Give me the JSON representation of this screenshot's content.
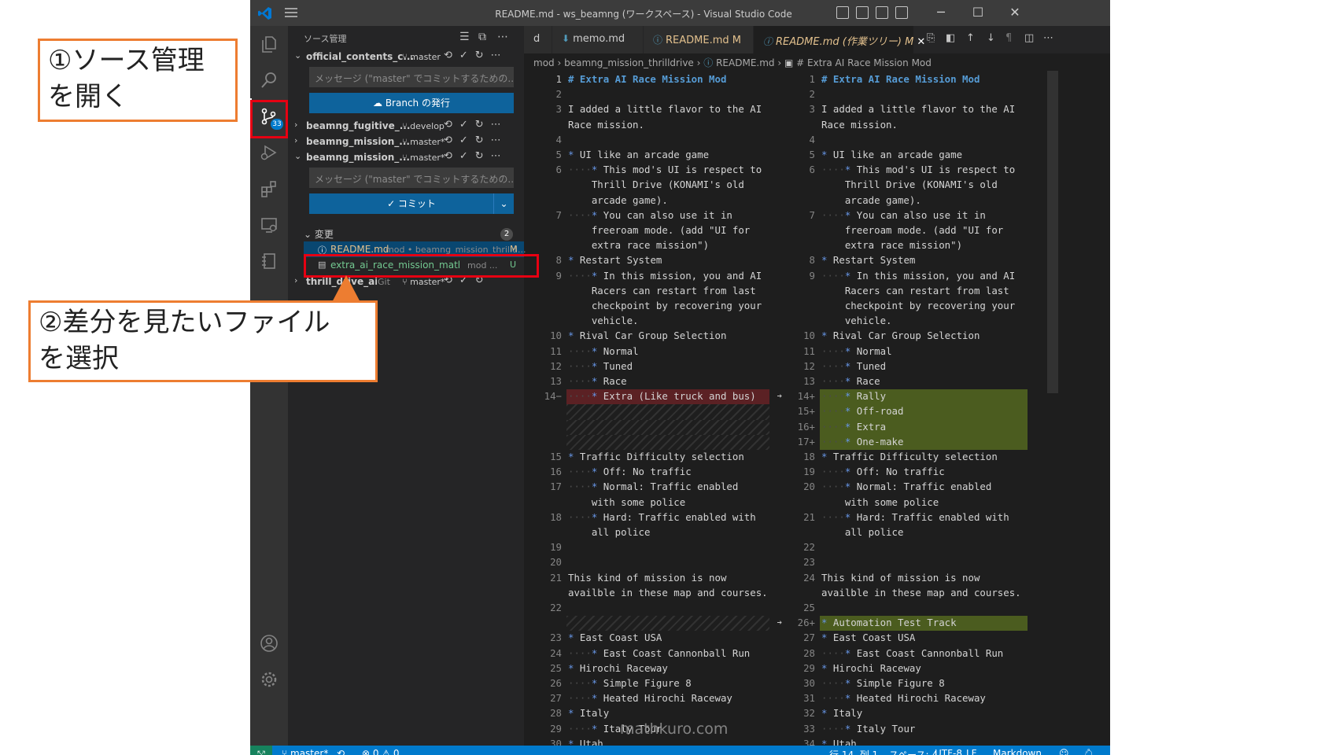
{
  "window": {
    "title": "README.md - ws_beamng (ワークスペース) - Visual Studio Code",
    "controls": [
      "─",
      "☐",
      "✕"
    ]
  },
  "activity_bar": {
    "scm_badge": "33"
  },
  "sidebar": {
    "title": "ソース管理",
    "repos": [
      {
        "name": "official_contents_c...",
        "branch": "master",
        "expanded": true
      },
      {
        "name": "beamng_fugitive_...",
        "branch": "develop",
        "expanded": false
      },
      {
        "name": "beamng_mission_...",
        "branch": "master*",
        "expanded": false
      },
      {
        "name": "beamng_mission_...",
        "branch": "master*",
        "expanded": true
      },
      {
        "name": "thrill_drive_ai...",
        "git_label": "Git",
        "branch": "master*",
        "expanded": false
      }
    ],
    "commit_placeholder": "メッセージ (\"master\" でコミットするための...",
    "publish_button": "Branch の発行",
    "commit_button": "✓ コミット",
    "changes_label": "変更",
    "changes_count": "2",
    "files": [
      {
        "name": "README.md",
        "desc": "mod • beamng_mission_thrilld...",
        "status": "M",
        "selected": true
      },
      {
        "name": "extra_ai_race_mission_mathkuro.zip",
        "desc": "mod ...",
        "status": "U",
        "selected": false
      }
    ]
  },
  "tabs": [
    {
      "label": "d",
      "active": false
    },
    {
      "label": "memo.md",
      "active": false
    },
    {
      "label": "README.md",
      "status": "M",
      "active": false
    },
    {
      "label": "README.md (作業ツリー)",
      "status": "M",
      "active": true
    }
  ],
  "breadcrumb": {
    "parts": [
      "mod",
      "beamng_mission_thrilldrive",
      "README.md",
      "# Extra AI Race Mission Mod"
    ]
  },
  "diff": {
    "left": [
      {
        "ln": "1",
        "t": "# Extra AI Race Mission Mod",
        "cur": true
      },
      {
        "ln": "2",
        "t": ""
      },
      {
        "ln": "3",
        "t": "I added a little flavor to the AI"
      },
      {
        "ln": "",
        "t": "Race mission."
      },
      {
        "ln": "4",
        "t": ""
      },
      {
        "ln": "5",
        "t": "* UI like an arcade game"
      },
      {
        "ln": "6",
        "t": "    * This mod's UI is respect to"
      },
      {
        "ln": "",
        "t": "    Thrill Drive (KONAMI's old"
      },
      {
        "ln": "",
        "t": "    arcade game)."
      },
      {
        "ln": "7",
        "t": "    * You can also use it in"
      },
      {
        "ln": "",
        "t": "    freeroam mode. (add \"UI for"
      },
      {
        "ln": "",
        "t": "    extra race mission\")"
      },
      {
        "ln": "8",
        "t": "* Restart System"
      },
      {
        "ln": "9",
        "t": "    * In this mission, you and AI"
      },
      {
        "ln": "",
        "t": "    Racers can restart from last"
      },
      {
        "ln": "",
        "t": "    checkpoint by recovering your"
      },
      {
        "ln": "",
        "t": "    vehicle."
      },
      {
        "ln": "10",
        "t": "* Rival Car Group Selection"
      },
      {
        "ln": "11",
        "t": "    * Normal"
      },
      {
        "ln": "12",
        "t": "    * Tuned"
      },
      {
        "ln": "13",
        "t": "    * Race"
      },
      {
        "ln": "14−",
        "t": "    * Extra (Like truck and bus)",
        "del": true
      },
      {
        "ln": "",
        "t": "",
        "hatch": true
      },
      {
        "ln": "",
        "t": "",
        "hatch": true
      },
      {
        "ln": "",
        "t": "",
        "hatch": true
      },
      {
        "ln": "15",
        "t": "* Traffic Difficulty selection"
      },
      {
        "ln": "16",
        "t": "    * Off: No traffic"
      },
      {
        "ln": "17",
        "t": "    * Normal: Traffic enabled"
      },
      {
        "ln": "",
        "t": "    with some police"
      },
      {
        "ln": "18",
        "t": "    * Hard: Traffic enabled with"
      },
      {
        "ln": "",
        "t": "    all police"
      },
      {
        "ln": "19",
        "t": ""
      },
      {
        "ln": "20",
        "t": ""
      },
      {
        "ln": "21",
        "t": "This kind of mission is now"
      },
      {
        "ln": "",
        "t": "availble in these map and courses."
      },
      {
        "ln": "22",
        "t": ""
      },
      {
        "ln": "",
        "t": "",
        "hatch": true
      },
      {
        "ln": "23",
        "t": "* East Coast USA"
      },
      {
        "ln": "24",
        "t": "    * East Coast Cannonball Run"
      },
      {
        "ln": "25",
        "t": "* Hirochi Raceway"
      },
      {
        "ln": "26",
        "t": "    * Simple Figure 8"
      },
      {
        "ln": "27",
        "t": "    * Heated Hirochi Raceway"
      },
      {
        "ln": "28",
        "t": "* Italy"
      },
      {
        "ln": "29",
        "t": "    * Italy Tour"
      },
      {
        "ln": "30",
        "t": "* Utah"
      }
    ],
    "right": [
      {
        "ln": "1",
        "t": "# Extra AI Race Mission Mod"
      },
      {
        "ln": "2",
        "t": ""
      },
      {
        "ln": "3",
        "t": "I added a little flavor to the AI"
      },
      {
        "ln": "",
        "t": "Race mission."
      },
      {
        "ln": "4",
        "t": ""
      },
      {
        "ln": "5",
        "t": "* UI like an arcade game"
      },
      {
        "ln": "6",
        "t": "    * This mod's UI is respect to"
      },
      {
        "ln": "",
        "t": "    Thrill Drive (KONAMI's old"
      },
      {
        "ln": "",
        "t": "    arcade game)."
      },
      {
        "ln": "7",
        "t": "    * You can also use it in"
      },
      {
        "ln": "",
        "t": "    freeroam mode. (add \"UI for"
      },
      {
        "ln": "",
        "t": "    extra race mission\")"
      },
      {
        "ln": "8",
        "t": "* Restart System"
      },
      {
        "ln": "9",
        "t": "    * In this mission, you and AI"
      },
      {
        "ln": "",
        "t": "    Racers can restart from last"
      },
      {
        "ln": "",
        "t": "    checkpoint by recovering your"
      },
      {
        "ln": "",
        "t": "    vehicle."
      },
      {
        "ln": "10",
        "t": "* Rival Car Group Selection"
      },
      {
        "ln": "11",
        "t": "    * Normal"
      },
      {
        "ln": "12",
        "t": "    * Tuned"
      },
      {
        "ln": "13",
        "t": "    * Race"
      },
      {
        "ln": "14+",
        "t": "    * Rally",
        "add": true,
        "arrow": true
      },
      {
        "ln": "15+",
        "t": "    * Off-road",
        "add": true
      },
      {
        "ln": "16+",
        "t": "    * Extra",
        "add": true
      },
      {
        "ln": "17+",
        "t": "    * One-make",
        "add": true
      },
      {
        "ln": "18",
        "t": "* Traffic Difficulty selection"
      },
      {
        "ln": "19",
        "t": "    * Off: No traffic"
      },
      {
        "ln": "20",
        "t": "    * Normal: Traffic enabled"
      },
      {
        "ln": "",
        "t": "    with some police"
      },
      {
        "ln": "21",
        "t": "    * Hard: Traffic enabled with"
      },
      {
        "ln": "",
        "t": "    all police"
      },
      {
        "ln": "22",
        "t": ""
      },
      {
        "ln": "23",
        "t": ""
      },
      {
        "ln": "24",
        "t": "This kind of mission is now"
      },
      {
        "ln": "",
        "t": "availble in these map and courses."
      },
      {
        "ln": "25",
        "t": ""
      },
      {
        "ln": "26+",
        "t": "* Automation Test Track",
        "add": true,
        "arrow": true
      },
      {
        "ln": "27",
        "t": "* East Coast USA"
      },
      {
        "ln": "28",
        "t": "    * East Coast Cannonball Run"
      },
      {
        "ln": "29",
        "t": "* Hirochi Raceway"
      },
      {
        "ln": "30",
        "t": "    * Simple Figure 8"
      },
      {
        "ln": "31",
        "t": "    * Heated Hirochi Raceway"
      },
      {
        "ln": "32",
        "t": "* Italy"
      },
      {
        "ln": "33",
        "t": "    * Italy Tour"
      },
      {
        "ln": "34",
        "t": "* Utah"
      }
    ]
  },
  "status_bar": {
    "branch": "master*",
    "problems": "⊗ 0 ⚠ 0",
    "position": "行 14, 列 1",
    "spaces": "スペース: 4",
    "encoding": "UTF-8",
    "eol": "LF",
    "language": "Markdown"
  },
  "watermark": "mathkuro.com",
  "annotations": {
    "step1": [
      "①ソース管理",
      "を開く"
    ],
    "step2": [
      "②差分を見たいファイル",
      "を選択"
    ]
  },
  "colors": {
    "accent": "#007acc",
    "highlight_box": "#e60012",
    "callout_border": "#ed7d31",
    "diff_removed": "#5b2124",
    "diff_added": "#4b5c1f"
  }
}
